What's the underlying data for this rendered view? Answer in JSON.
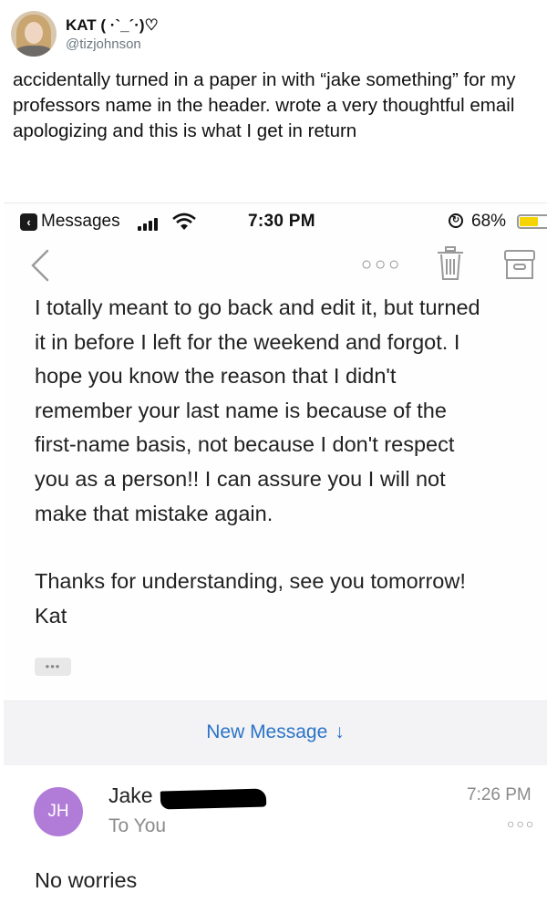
{
  "tweet": {
    "display_name": "KAT ( ·`_´·)♡",
    "handle": "@tizjohnson",
    "text": "accidentally turned in a paper in with “jake something” for my professors name in the header. wrote a very thoughtful email apologizing and this is what I get in return"
  },
  "status_bar": {
    "back_app": "Messages",
    "time": "7:30 PM",
    "battery_percent": "68%",
    "battery_level": 0.68,
    "battery_color": "#f5d400"
  },
  "email": {
    "body_lines": [
      "I totally meant to go back and edit it, but turned",
      "it in before I left for the weekend and forgot. I",
      "hope you know the reason that I didn't",
      "remember your last name is because of the",
      "first-name basis, not because I don't respect",
      "you as a person!! I can assure you I will not",
      "make that mistake again."
    ],
    "closing": "Thanks for understanding, see you tomorrow!",
    "signature": "Kat",
    "quoted_toggle": "•••"
  },
  "new_message": {
    "label": "New Message",
    "arrow": "↓",
    "color": "#2a73c6"
  },
  "reply": {
    "initials": "JH",
    "avatar_color": "#b17bd8",
    "sender": "Jake",
    "recipient": "To You",
    "time": "7:26 PM",
    "body": "No worries"
  },
  "icons": [
    "back-chevron-icon",
    "more-dots-icon",
    "trash-icon",
    "archive-icon",
    "signal-icon",
    "wifi-icon",
    "lock-rotation-icon",
    "battery-icon"
  ]
}
